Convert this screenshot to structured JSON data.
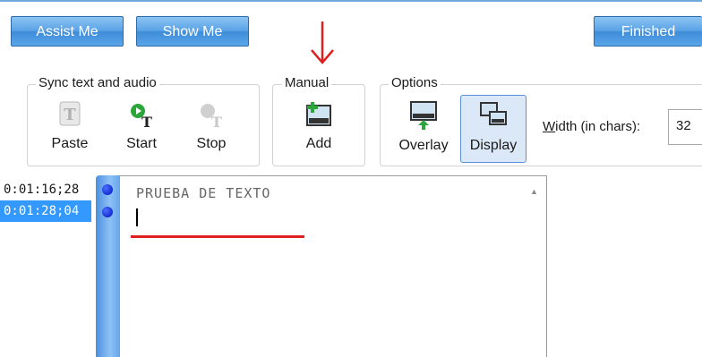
{
  "header": {
    "assist_label": "Assist Me",
    "show_label": "Show Me",
    "finished_label": "Finished"
  },
  "toolbar": {
    "sync_group": {
      "title": "Sync text and audio",
      "paste_label": "Paste",
      "start_label": "Start",
      "stop_label": "Stop"
    },
    "manual_group": {
      "title": "Manual",
      "add_label": "Add"
    },
    "options_group": {
      "title": "Options",
      "overlay_label": "Overlay",
      "display_label": "Display",
      "width_label_mnemonic": "W",
      "width_label_rest": "idth (in chars):",
      "width_value": "32"
    }
  },
  "captions": {
    "times": [
      "0:01:16;28",
      "0:01:28;04"
    ],
    "selected_index": 1,
    "text_line": "PRUEBA DE TEXTO"
  },
  "colors": {
    "accent_blue": "#3f8cd8",
    "annotation_red": "#e02020",
    "selection": "#3399ff"
  }
}
